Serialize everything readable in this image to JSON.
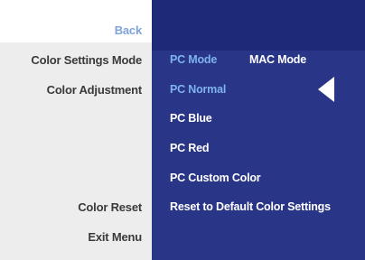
{
  "menu": {
    "back": "Back",
    "color_settings_mode": "Color Settings Mode",
    "color_adjustment": "Color Adjustment",
    "color_reset": "Color Reset",
    "exit_menu": "Exit Menu"
  },
  "options": {
    "pc_mode": "PC Mode",
    "mac_mode": "MAC Mode",
    "pc_normal": "PC Normal",
    "pc_blue": "PC Blue",
    "pc_red": "PC Red",
    "pc_custom_color": "PC Custom Color",
    "reset_default": "Reset to Default Color Settings"
  },
  "colors": {
    "panel": "#293587",
    "panel_header": "#1e2a78",
    "highlight": "#7eb3ee",
    "back": "#7da3d9"
  },
  "icons": {
    "selector": "left-triangle-arrow-icon"
  }
}
